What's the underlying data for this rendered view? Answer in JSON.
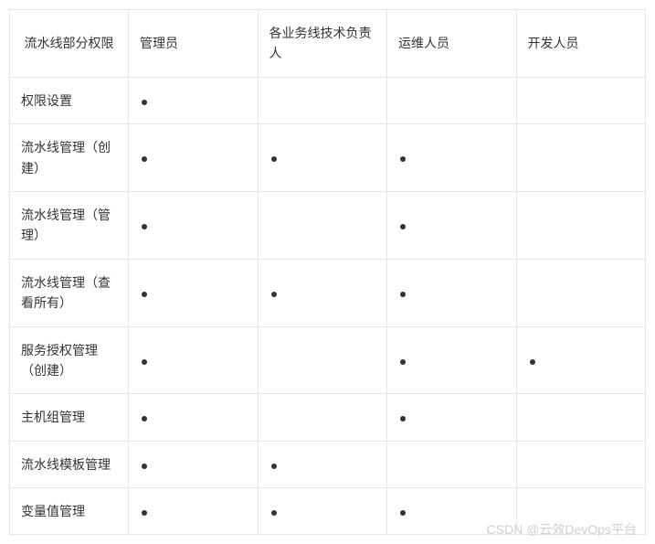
{
  "table": {
    "headers": [
      "流水线部分权限",
      "管理员",
      "各业务线技术负责人",
      "运维人员",
      "开发人员"
    ],
    "rows": [
      {
        "label": "权限设置",
        "cells": [
          true,
          false,
          false,
          false
        ]
      },
      {
        "label": "流水线管理（创建）",
        "cells": [
          true,
          true,
          true,
          false
        ]
      },
      {
        "label": "流水线管理（管理）",
        "cells": [
          true,
          false,
          true,
          false
        ]
      },
      {
        "label": "流水线管理（查看所有）",
        "cells": [
          true,
          true,
          true,
          false
        ]
      },
      {
        "label": "服务授权管理（创建）",
        "cells": [
          true,
          false,
          true,
          true
        ]
      },
      {
        "label": "主机组管理",
        "cells": [
          true,
          false,
          true,
          false
        ]
      },
      {
        "label": "流水线模板管理",
        "cells": [
          true,
          true,
          false,
          false
        ]
      },
      {
        "label": "变量值管理",
        "cells": [
          true,
          true,
          true,
          false
        ]
      }
    ]
  },
  "watermark": "CSDN @云效DevOps平台"
}
